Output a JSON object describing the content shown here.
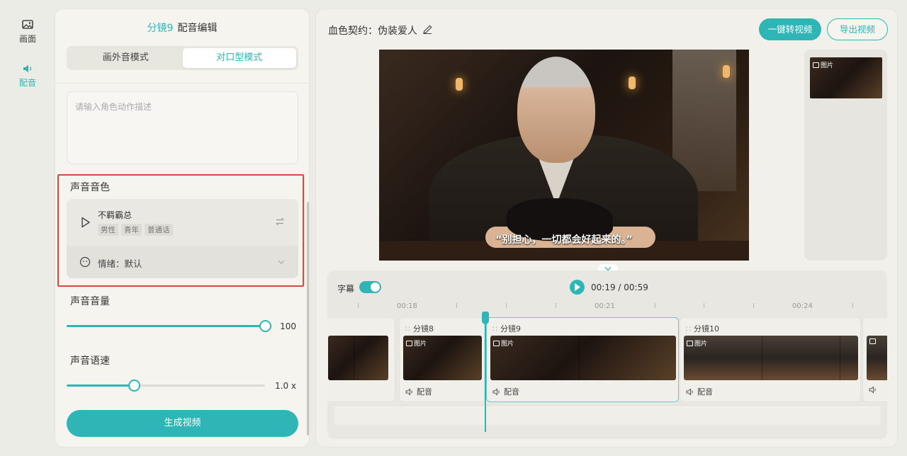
{
  "rail": {
    "items": [
      {
        "label": "画面",
        "icon": "image-icon",
        "active": false
      },
      {
        "label": "配音",
        "icon": "speaker-icon",
        "active": true
      }
    ]
  },
  "editor": {
    "title_shot": "分镜9",
    "title_text": "配音编辑",
    "modes": [
      "画外音模式",
      "对口型模式"
    ],
    "active_mode": "对口型模式",
    "action_placeholder": "请输入角色动作描述",
    "voice_section": "声音音色",
    "voice": {
      "name": "不羁霸总",
      "tags": [
        "男性",
        "青年",
        "普通话"
      ]
    },
    "emotion": "情绪：默认",
    "volume_section": "声音音量",
    "volume_value": "100",
    "volume_fraction": 1.0,
    "speed_section": "声音语速",
    "speed_value": "1.0 x",
    "speed_fraction": 0.34,
    "generate_label": "生成视频"
  },
  "workspace": {
    "project_title": "血色契约：伪装爱人",
    "convert_label": "一键转视频",
    "export_label": "导出视频",
    "subtitle_text": "“别担心，一切都会好起来的。”",
    "thumb_badge": "图片"
  },
  "timeline": {
    "subtitle_label": "字幕",
    "subtitle_on": true,
    "time_display": "00:19 / 00:59",
    "ticks": [
      "00:18",
      "00:21",
      "00:24"
    ],
    "clips": [
      {
        "title": "分镜8",
        "badge": "图片",
        "audio": "配音"
      },
      {
        "title": "分镜9",
        "badge": "图片",
        "audio": "配音"
      },
      {
        "title": "分镜10",
        "badge": "图片",
        "audio": "配音"
      }
    ]
  },
  "colors": {
    "accent": "#2fb5b5",
    "highlight_border": "#e0443b",
    "background": "#ecece6"
  }
}
